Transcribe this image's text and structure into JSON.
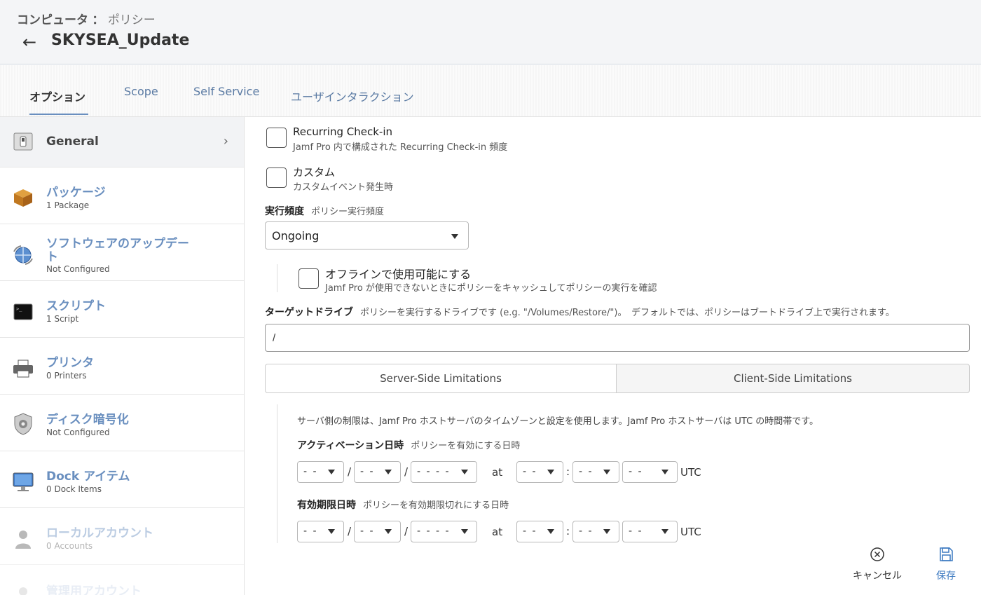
{
  "header": {
    "breadcrumb_section": "コンピュータ",
    "breadcrumb_sep": "：",
    "breadcrumb_page": "ポリシー",
    "back_icon": "←",
    "title": "SKYSEA_Update"
  },
  "tabs": [
    {
      "label": "オプション"
    },
    {
      "label": "Scope"
    },
    {
      "label": "Self Service"
    },
    {
      "label": "ユーザインタラクション"
    }
  ],
  "sidebar": {
    "items": [
      {
        "label": "General",
        "sub": ""
      },
      {
        "label": "パッケージ",
        "sub": "1 Package"
      },
      {
        "label": "ソフトウェアのアップデート",
        "sub": "Not Configured"
      },
      {
        "label": "スクリプト",
        "sub": "1 Script"
      },
      {
        "label": "プリンタ",
        "sub": "0 Printers"
      },
      {
        "label": "ディスク暗号化",
        "sub": "Not Configured"
      },
      {
        "label": "Dock アイテム",
        "sub": "0 Dock Items"
      },
      {
        "label": "ローカルアカウント",
        "sub": "0 Accounts"
      },
      {
        "label": "管理用アカウント",
        "sub": ""
      }
    ]
  },
  "main": {
    "recurring": {
      "title": "Recurring Check-in",
      "sub": "Jamf Pro 内で構成された Recurring Check-in 頻度"
    },
    "custom": {
      "title": "カスタム",
      "sub": "カスタムイベント発生時"
    },
    "frequency": {
      "label": "実行頻度",
      "desc": "ポリシー実行頻度",
      "value": "Ongoing"
    },
    "offline": {
      "title": "オフラインで使用可能にする",
      "sub": "Jamf Pro が使用できないときにポリシーをキャッシュしてポリシーの実行を確認"
    },
    "target": {
      "label": "ターゲットドライブ",
      "desc": "ポリシーを実行するドライブです (e.g. \"/Volumes/Restore/\")。　デフォルトでは、ポリシーはブートドライブ上で実行されます。",
      "value": "/"
    },
    "limitations": {
      "server": "Server-Side Limitations",
      "client": "Client-Side Limitations"
    },
    "note": "サーバ側の制限は、Jamf Pro ホストサーバのタイムゾーンと設定を使用します。Jamf Pro ホストサーバは UTC の時間帯です。",
    "activation": {
      "label": "アクティベーション日時",
      "desc": "ポリシーを有効にする日時"
    },
    "expiration": {
      "label": "有効期限日時",
      "desc": "ポリシーを有効期限切れにする日時"
    },
    "date_placeholder_2": "- -",
    "date_placeholder_4": "- - - -",
    "slash": "/",
    "at": "at",
    "colon": ":",
    "utc": "UTC"
  },
  "footer": {
    "cancel": "キャンセル",
    "save": "保存"
  }
}
